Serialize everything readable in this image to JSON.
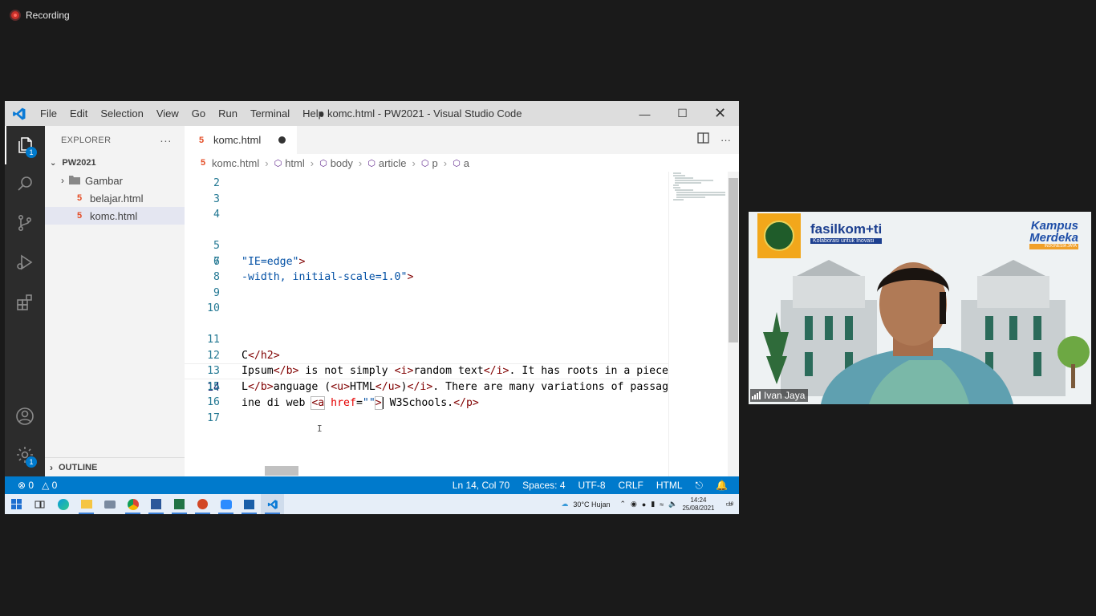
{
  "recording": {
    "label": "Recording"
  },
  "window": {
    "title": "● komc.html - PW2021 - Visual Studio Code",
    "menus": [
      "File",
      "Edit",
      "Selection",
      "View",
      "Go",
      "Run",
      "Terminal",
      "Help"
    ]
  },
  "activity": {
    "explorer_badge": "1",
    "settings_badge": "1"
  },
  "sidebar": {
    "header": "EXPLORER",
    "more": "···",
    "project": "PW2021",
    "items": [
      {
        "label": "Gambar",
        "type": "folder"
      },
      {
        "label": "belajar.html",
        "type": "html"
      },
      {
        "label": "komc.html",
        "type": "html"
      }
    ],
    "outline": "OUTLINE"
  },
  "tab": {
    "label": "komc.html"
  },
  "breadcrumb": [
    "komc.html",
    "html",
    "body",
    "article",
    "p",
    "a"
  ],
  "code": {
    "line_numbers": [
      "2",
      "3",
      "4",
      "5",
      "6",
      "7",
      "8",
      "9",
      "10",
      "11",
      "12",
      "13",
      "14",
      "15",
      "16",
      "17"
    ],
    "l5_s": "\"IE=edge\"",
    "l5_t": ">",
    "l6_s": "-width, initial-scale=1.0\"",
    "l6_t": ">",
    "l11_a": "C",
    "l11_t": "</h2>",
    "l12_a": "Ipsum",
    "l12_t1": "</b>",
    "l12_b": " is not simply ",
    "l12_t2": "<i>",
    "l12_c": "random text",
    "l12_t3": "</i>",
    "l12_d": ". It has roots in a piece",
    "l13_a": "L",
    "l13_t1": "</b>",
    "l13_b": "anguage (",
    "l13_t2": "<u>",
    "l13_c": "HTML",
    "l13_t3": "</u>",
    "l13_d": ")",
    "l13_t4": "</i>",
    "l13_e": ". There are many variations of passage",
    "l14_a": "ine di web ",
    "l14_t1": "<a",
    "l14_attr": " href",
    "l14_eq": "=",
    "l14_s": "\"\"",
    "l14_t2": ">",
    "l14_b": " W3Schools.",
    "l14_t3": "</p>"
  },
  "status": {
    "errors": "0",
    "warnings": "0",
    "position": "Ln 14, Col 70",
    "spaces": "Spaces: 4",
    "encoding": "UTF-8",
    "eol": "CRLF",
    "language": "HTML"
  },
  "taskbar": {
    "weather": "30°C  Hujan",
    "time": "14:24",
    "date": "25/08/2021",
    "notifications": "10"
  },
  "camera": {
    "name": "Ivan Jaya",
    "brand": "fasilkom+ti",
    "brand_sub": "Kolaborasi untuk Inovasi",
    "kampus": "Kampus",
    "merdeka": "Merdeka",
    "kampus_sub": "INDONESIA JAYA"
  }
}
